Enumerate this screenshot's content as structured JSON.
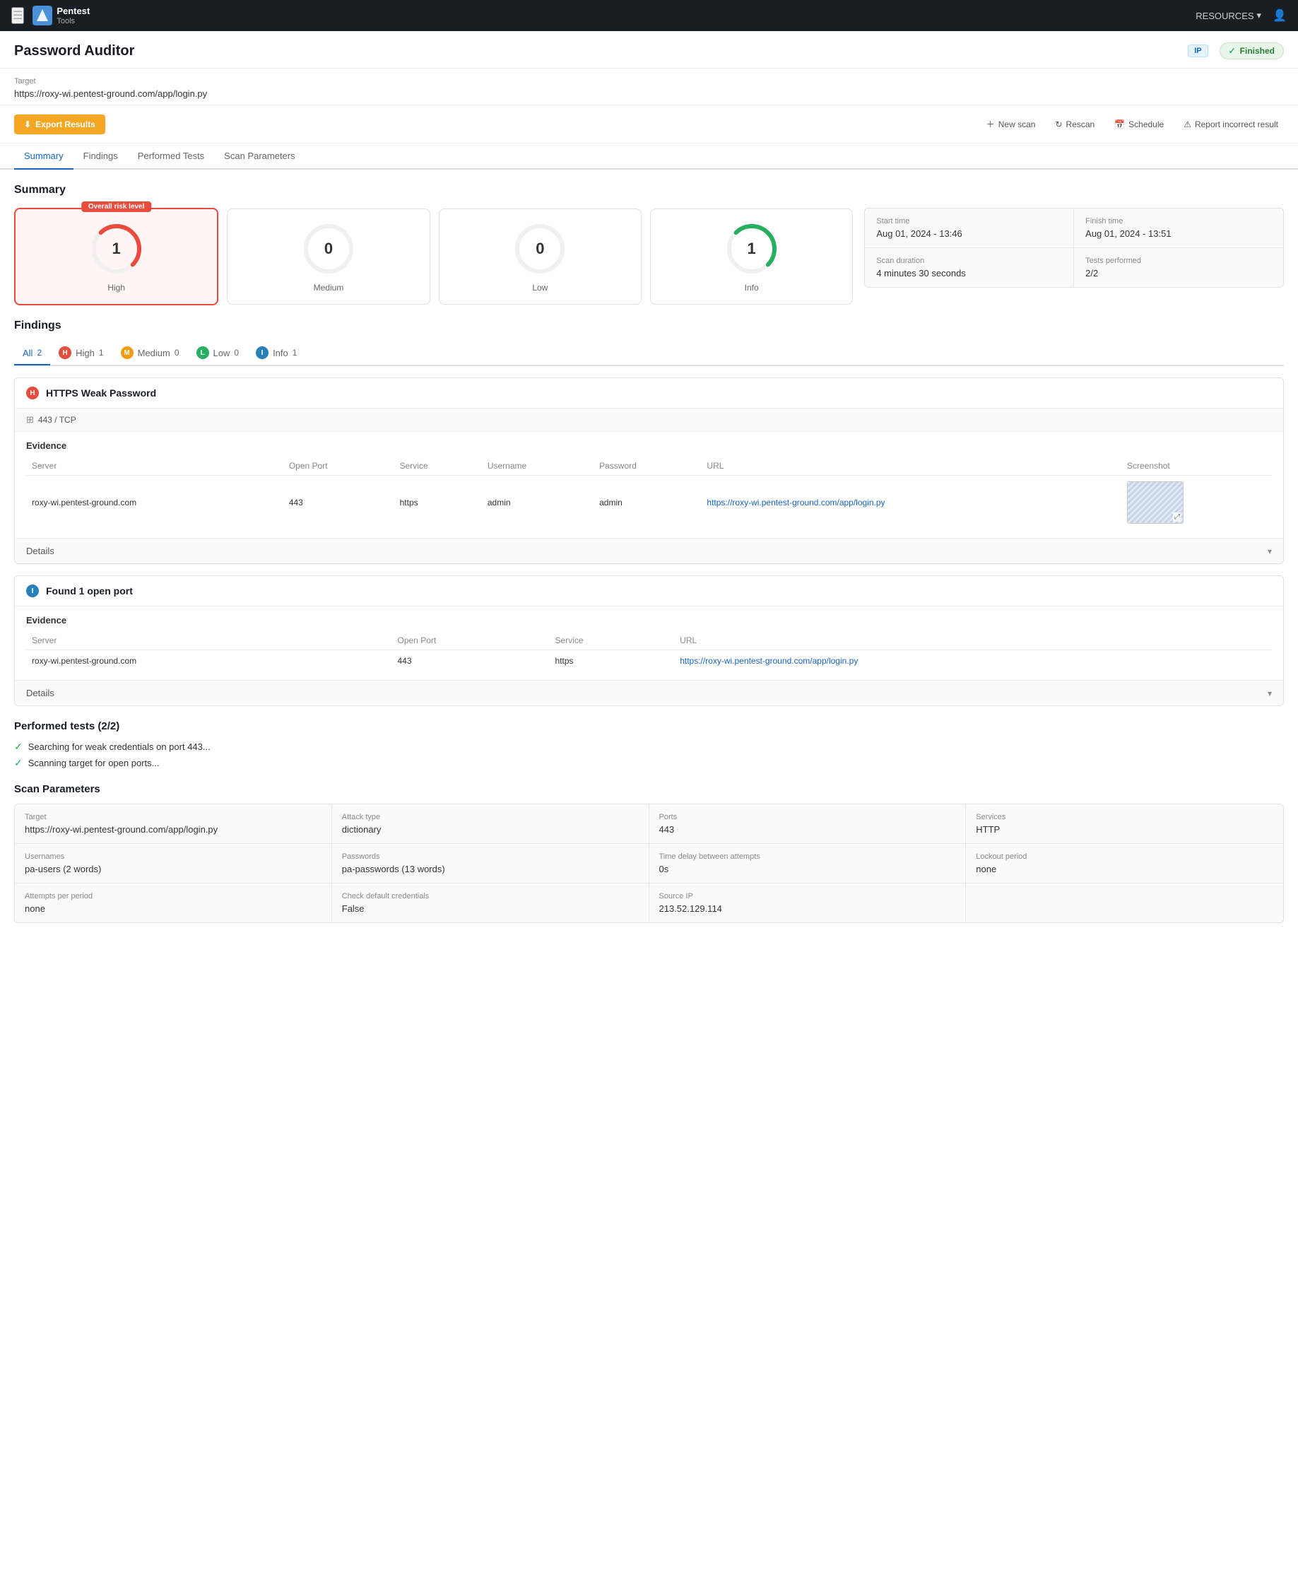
{
  "topnav": {
    "logo_line1": "Pentest",
    "logo_line2": "Tools",
    "resources_label": "RESOURCES",
    "chevron": "▾"
  },
  "page": {
    "title": "Password Auditor",
    "status_badge": "Finished",
    "badge_check": "✓",
    "ip_label": "IP"
  },
  "target": {
    "label": "Target",
    "url": "https://roxy-wi.pentest-ground.com/app/login.py"
  },
  "actions": {
    "export_label": "Export Results",
    "new_scan_label": "New scan",
    "rescan_label": "Rescan",
    "schedule_label": "Schedule",
    "report_label": "Report incorrect result"
  },
  "tabs": [
    {
      "label": "Summary",
      "active": true
    },
    {
      "label": "Findings",
      "active": false
    },
    {
      "label": "Performed Tests",
      "active": false
    },
    {
      "label": "Scan Parameters",
      "active": false
    }
  ],
  "summary": {
    "title": "Summary",
    "overall_label": "Overall risk level",
    "gauges": [
      {
        "value": "1",
        "label": "High",
        "color": "#e74c3c",
        "arc": "high"
      },
      {
        "value": "0",
        "label": "Medium",
        "color": "#e0e0e0",
        "arc": "none"
      },
      {
        "value": "0",
        "label": "Low",
        "color": "#e0e0e0",
        "arc": "none"
      },
      {
        "value": "1",
        "label": "Info",
        "color": "#27ae60",
        "arc": "info"
      }
    ],
    "info_cards": [
      {
        "label": "Start time",
        "value": "Aug 01, 2024 - 13:46"
      },
      {
        "label": "Finish time",
        "value": "Aug 01, 2024 - 13:51"
      },
      {
        "label": "Scan duration",
        "value": "4 minutes 30 seconds"
      },
      {
        "label": "Tests performed",
        "value": "2/2"
      }
    ]
  },
  "findings": {
    "title": "Findings",
    "filter_tabs": [
      {
        "label": "All",
        "count": "2",
        "active": true,
        "badge": null
      },
      {
        "label": "High",
        "count": "1",
        "active": false,
        "badge": "H",
        "badge_class": "badge-high"
      },
      {
        "label": "Medium",
        "count": "0",
        "active": false,
        "badge": "M",
        "badge_class": "badge-medium"
      },
      {
        "label": "Low",
        "count": "0",
        "active": false,
        "badge": "L",
        "badge_class": "badge-low"
      },
      {
        "label": "Info",
        "count": "1",
        "active": false,
        "badge": "I",
        "badge_class": "badge-info"
      }
    ],
    "items": [
      {
        "id": "finding-1",
        "severity": "H",
        "severity_class": "badge-high",
        "title": "HTTPS Weak Password",
        "port": "443 / TCP",
        "has_evidence": true,
        "evidence_columns": [
          "Server",
          "Open Port",
          "Service",
          "Username",
          "Password",
          "URL",
          "Screenshot"
        ],
        "evidence_rows": [
          {
            "server": "roxy-wi.pentest-ground.com",
            "open_port": "443",
            "service": "https",
            "username": "admin",
            "password": "admin",
            "url": "https://roxy-wi.pentest-ground.com/app/login.py",
            "has_screenshot": true
          }
        ],
        "details_label": "Details"
      },
      {
        "id": "finding-2",
        "severity": "I",
        "severity_class": "badge-info",
        "title": "Found 1 open port",
        "port": null,
        "has_evidence": true,
        "evidence_columns": [
          "Server",
          "Open Port",
          "Service",
          "URL"
        ],
        "evidence_rows": [
          {
            "server": "roxy-wi.pentest-ground.com",
            "open_port": "443",
            "service": "https",
            "url": "https://roxy-wi.pentest-ground.com/app/login.py"
          }
        ],
        "details_label": "Details"
      }
    ]
  },
  "performed_tests": {
    "title": "Performed tests (2/2)",
    "items": [
      "Searching for weak credentials on port 443...",
      "Scanning target for open ports..."
    ]
  },
  "scan_params": {
    "title": "Scan Parameters",
    "params": [
      {
        "label": "Target",
        "value": "https://roxy-wi.pentest-ground.com/app/login.py"
      },
      {
        "label": "Attack type",
        "value": "dictionary"
      },
      {
        "label": "Ports",
        "value": "443"
      },
      {
        "label": "Services",
        "value": "HTTP"
      },
      {
        "label": "Usernames",
        "value": "pa-users (2 words)"
      },
      {
        "label": "Passwords",
        "value": "pa-passwords (13 words)"
      },
      {
        "label": "Time delay between attempts",
        "value": "0s"
      },
      {
        "label": "Lockout period",
        "value": "none"
      },
      {
        "label": "Attempts per period",
        "value": "none"
      },
      {
        "label": "Check default credentials",
        "value": "False"
      },
      {
        "label": "Source IP",
        "value": "213.52.129.114"
      }
    ]
  }
}
